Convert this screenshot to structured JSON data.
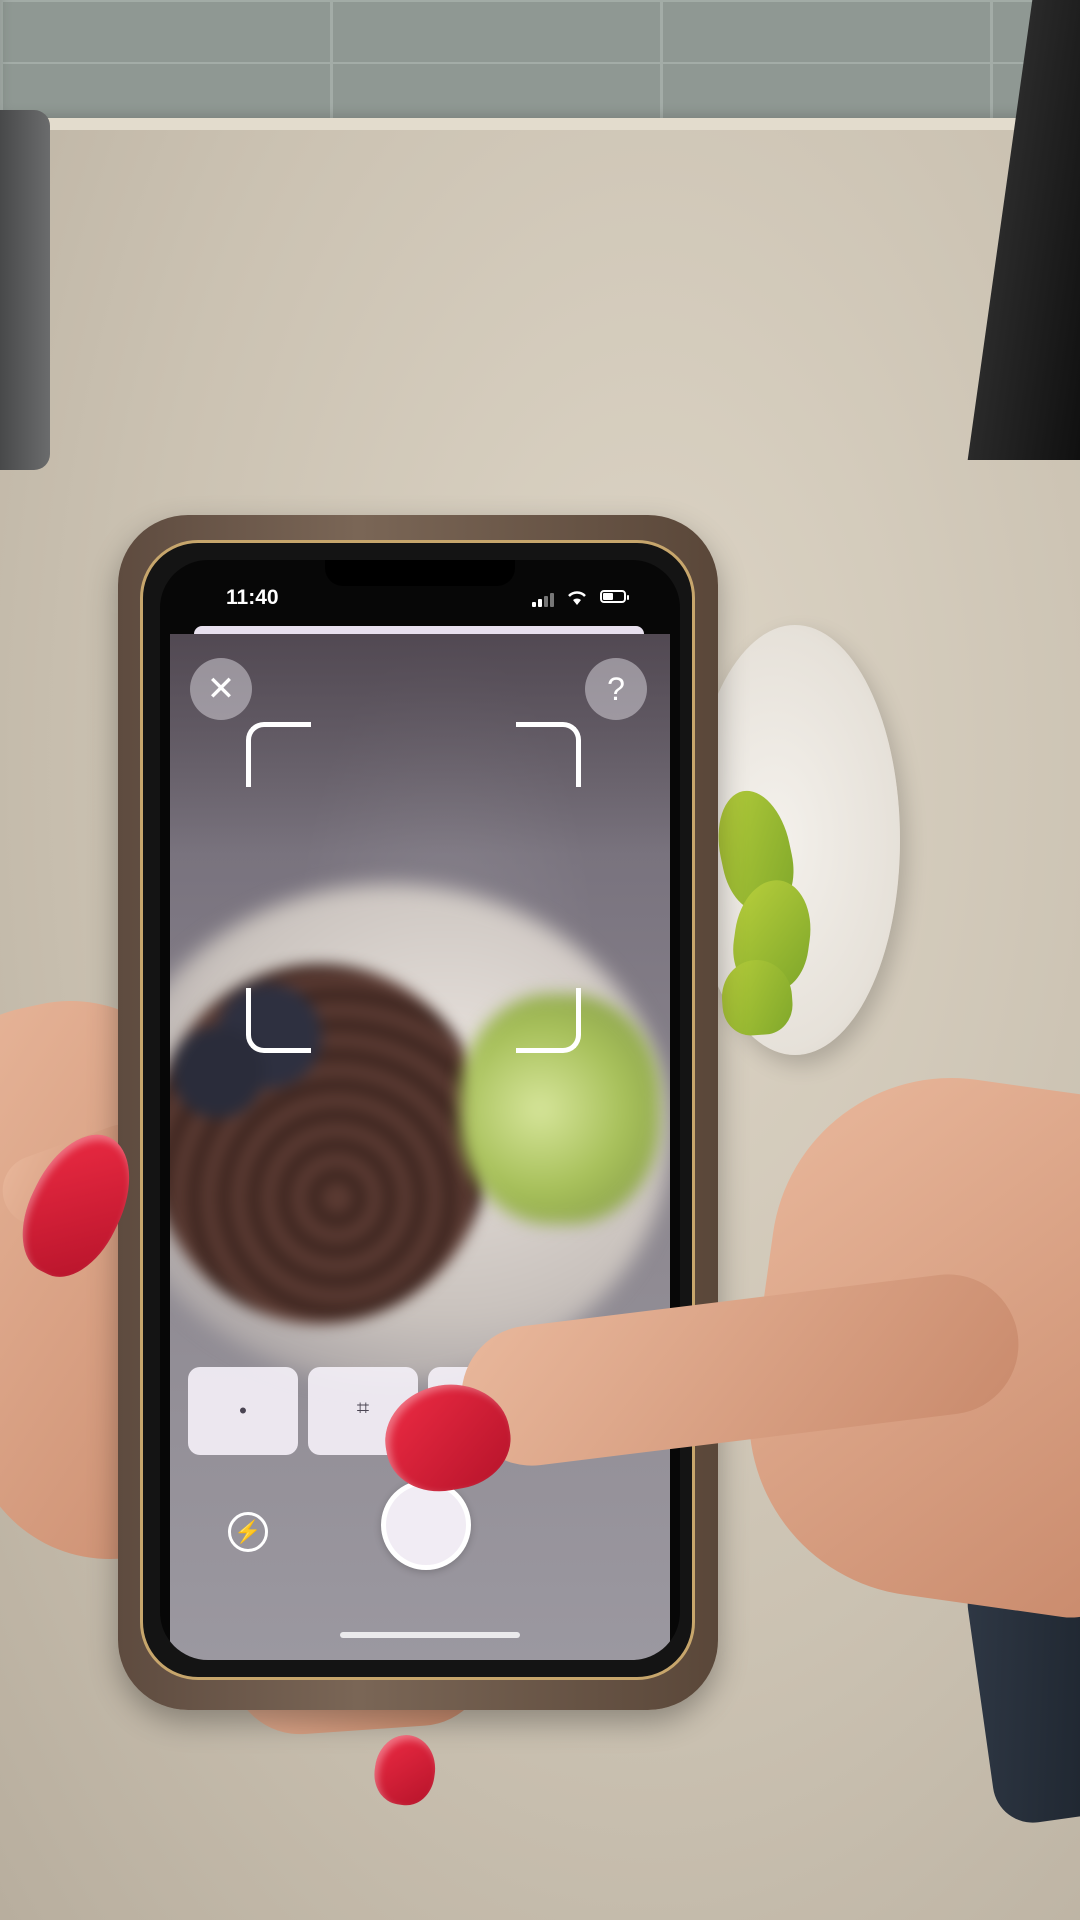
{
  "status_bar": {
    "time": "11:40",
    "icons": [
      "signal-icon",
      "wifi-icon",
      "battery-icon"
    ]
  },
  "camera": {
    "close_icon": "close-icon",
    "close_glyph": "✕",
    "help_icon": "help-icon",
    "help_glyph": "?",
    "mode_tiles": [
      {
        "icon": "dot-icon",
        "glyph": "•",
        "label": ""
      },
      {
        "icon": "scan-frame-icon",
        "glyph": "⌗",
        "label": ""
      },
      {
        "icon": "mode-icon",
        "glyph": "",
        "label": ""
      }
    ],
    "flash_icon": "flash-icon",
    "flash_glyph": "⚡",
    "shutter_icon": "shutter-button"
  },
  "colors": {
    "nail_polish": "#d81b34",
    "phone_frame_accent": "#c7a66c",
    "tile_background": "#f3eff6"
  }
}
